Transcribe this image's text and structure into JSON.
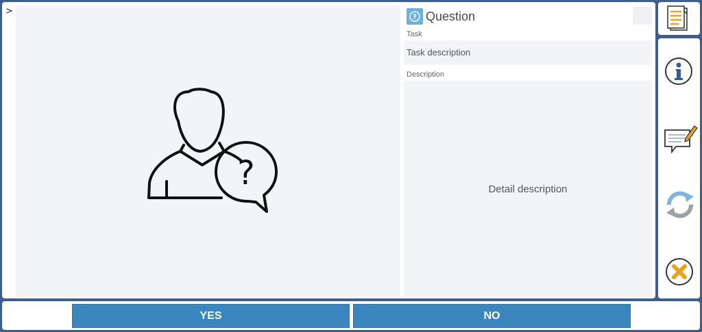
{
  "toggle": {
    "glyph": ">"
  },
  "question": {
    "title": "Question",
    "task_label": "Task",
    "task_value": "Task description",
    "description_label": "Description",
    "description_value": "Detail description"
  },
  "sidebar": {
    "buttons": [
      {
        "icon": "document-icon"
      },
      {
        "icon": "info-icon"
      },
      {
        "icon": "comment-edit-icon"
      },
      {
        "icon": "refresh-icon"
      },
      {
        "icon": "cancel-icon"
      }
    ]
  },
  "actions": {
    "yes_label": "YES",
    "no_label": "NO"
  },
  "colors": {
    "frame": "#3f5f8a",
    "button": "#3b86bf",
    "question_icon": "#6ab1dd",
    "cancel_icon": "#e5a521",
    "info_icon": "#2f5f93"
  }
}
